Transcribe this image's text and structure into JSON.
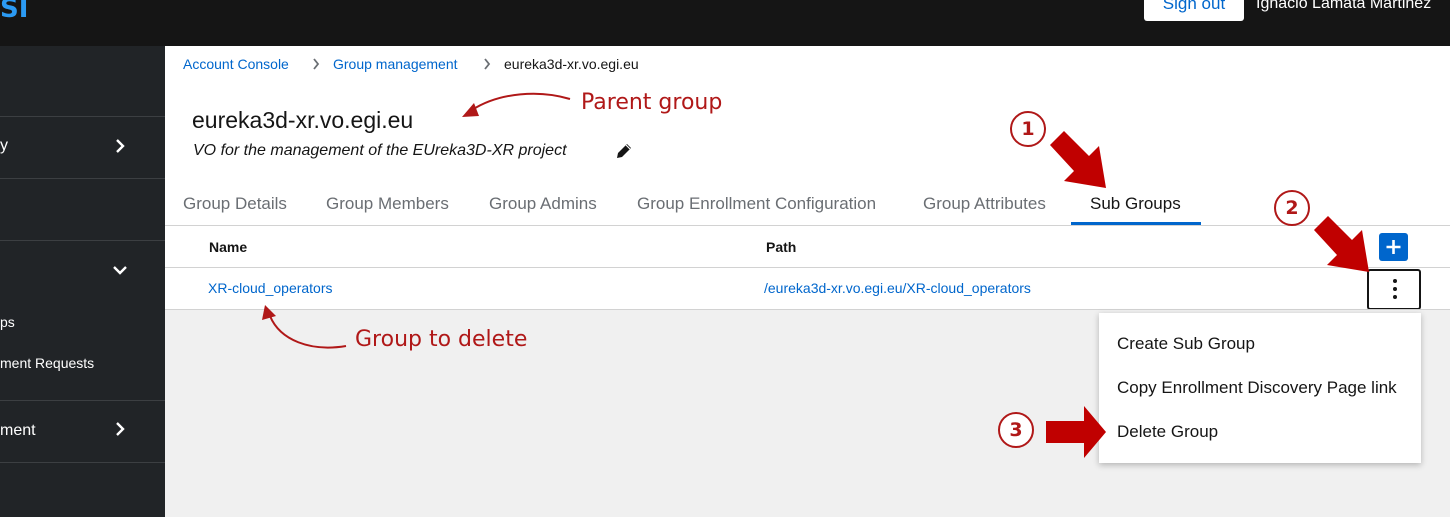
{
  "header": {
    "logo_text": "SI",
    "sign_out_label": "Sign out",
    "username": "Ignacio Lamata Martinez"
  },
  "sidebar": {
    "items": [
      {
        "label": "y"
      },
      {
        "label": "ps"
      },
      {
        "label": "ment Requests"
      },
      {
        "label": "ment"
      }
    ]
  },
  "breadcrumb": {
    "items": [
      "Account Console",
      "Group management",
      "eureka3d-xr.vo.egi.eu"
    ]
  },
  "group": {
    "title": "eureka3d-xr.vo.egi.eu",
    "description": "VO for the management of the EUreka3D-XR project"
  },
  "tabs": [
    {
      "label": "Group Details"
    },
    {
      "label": "Group Members"
    },
    {
      "label": "Group Admins"
    },
    {
      "label": "Group Enrollment Configuration"
    },
    {
      "label": "Group Attributes"
    },
    {
      "label": "Sub Groups",
      "active": true
    }
  ],
  "table": {
    "columns": [
      "Name",
      "Path"
    ],
    "rows": [
      {
        "name": "XR-cloud_operators",
        "path": "/eureka3d-xr.vo.egi.eu/XR-cloud_operators"
      }
    ]
  },
  "menu": {
    "items": [
      "Create Sub Group",
      "Copy Enrollment Discovery Page link",
      "Delete Group"
    ]
  },
  "annotations": {
    "parent_group": "Parent group",
    "group_to_delete": "Group to delete",
    "step1": "1",
    "step2": "2",
    "step3": "3"
  },
  "colors": {
    "accent": "#0066cc",
    "annotation": "#b01818",
    "arrow": "#c00000"
  }
}
